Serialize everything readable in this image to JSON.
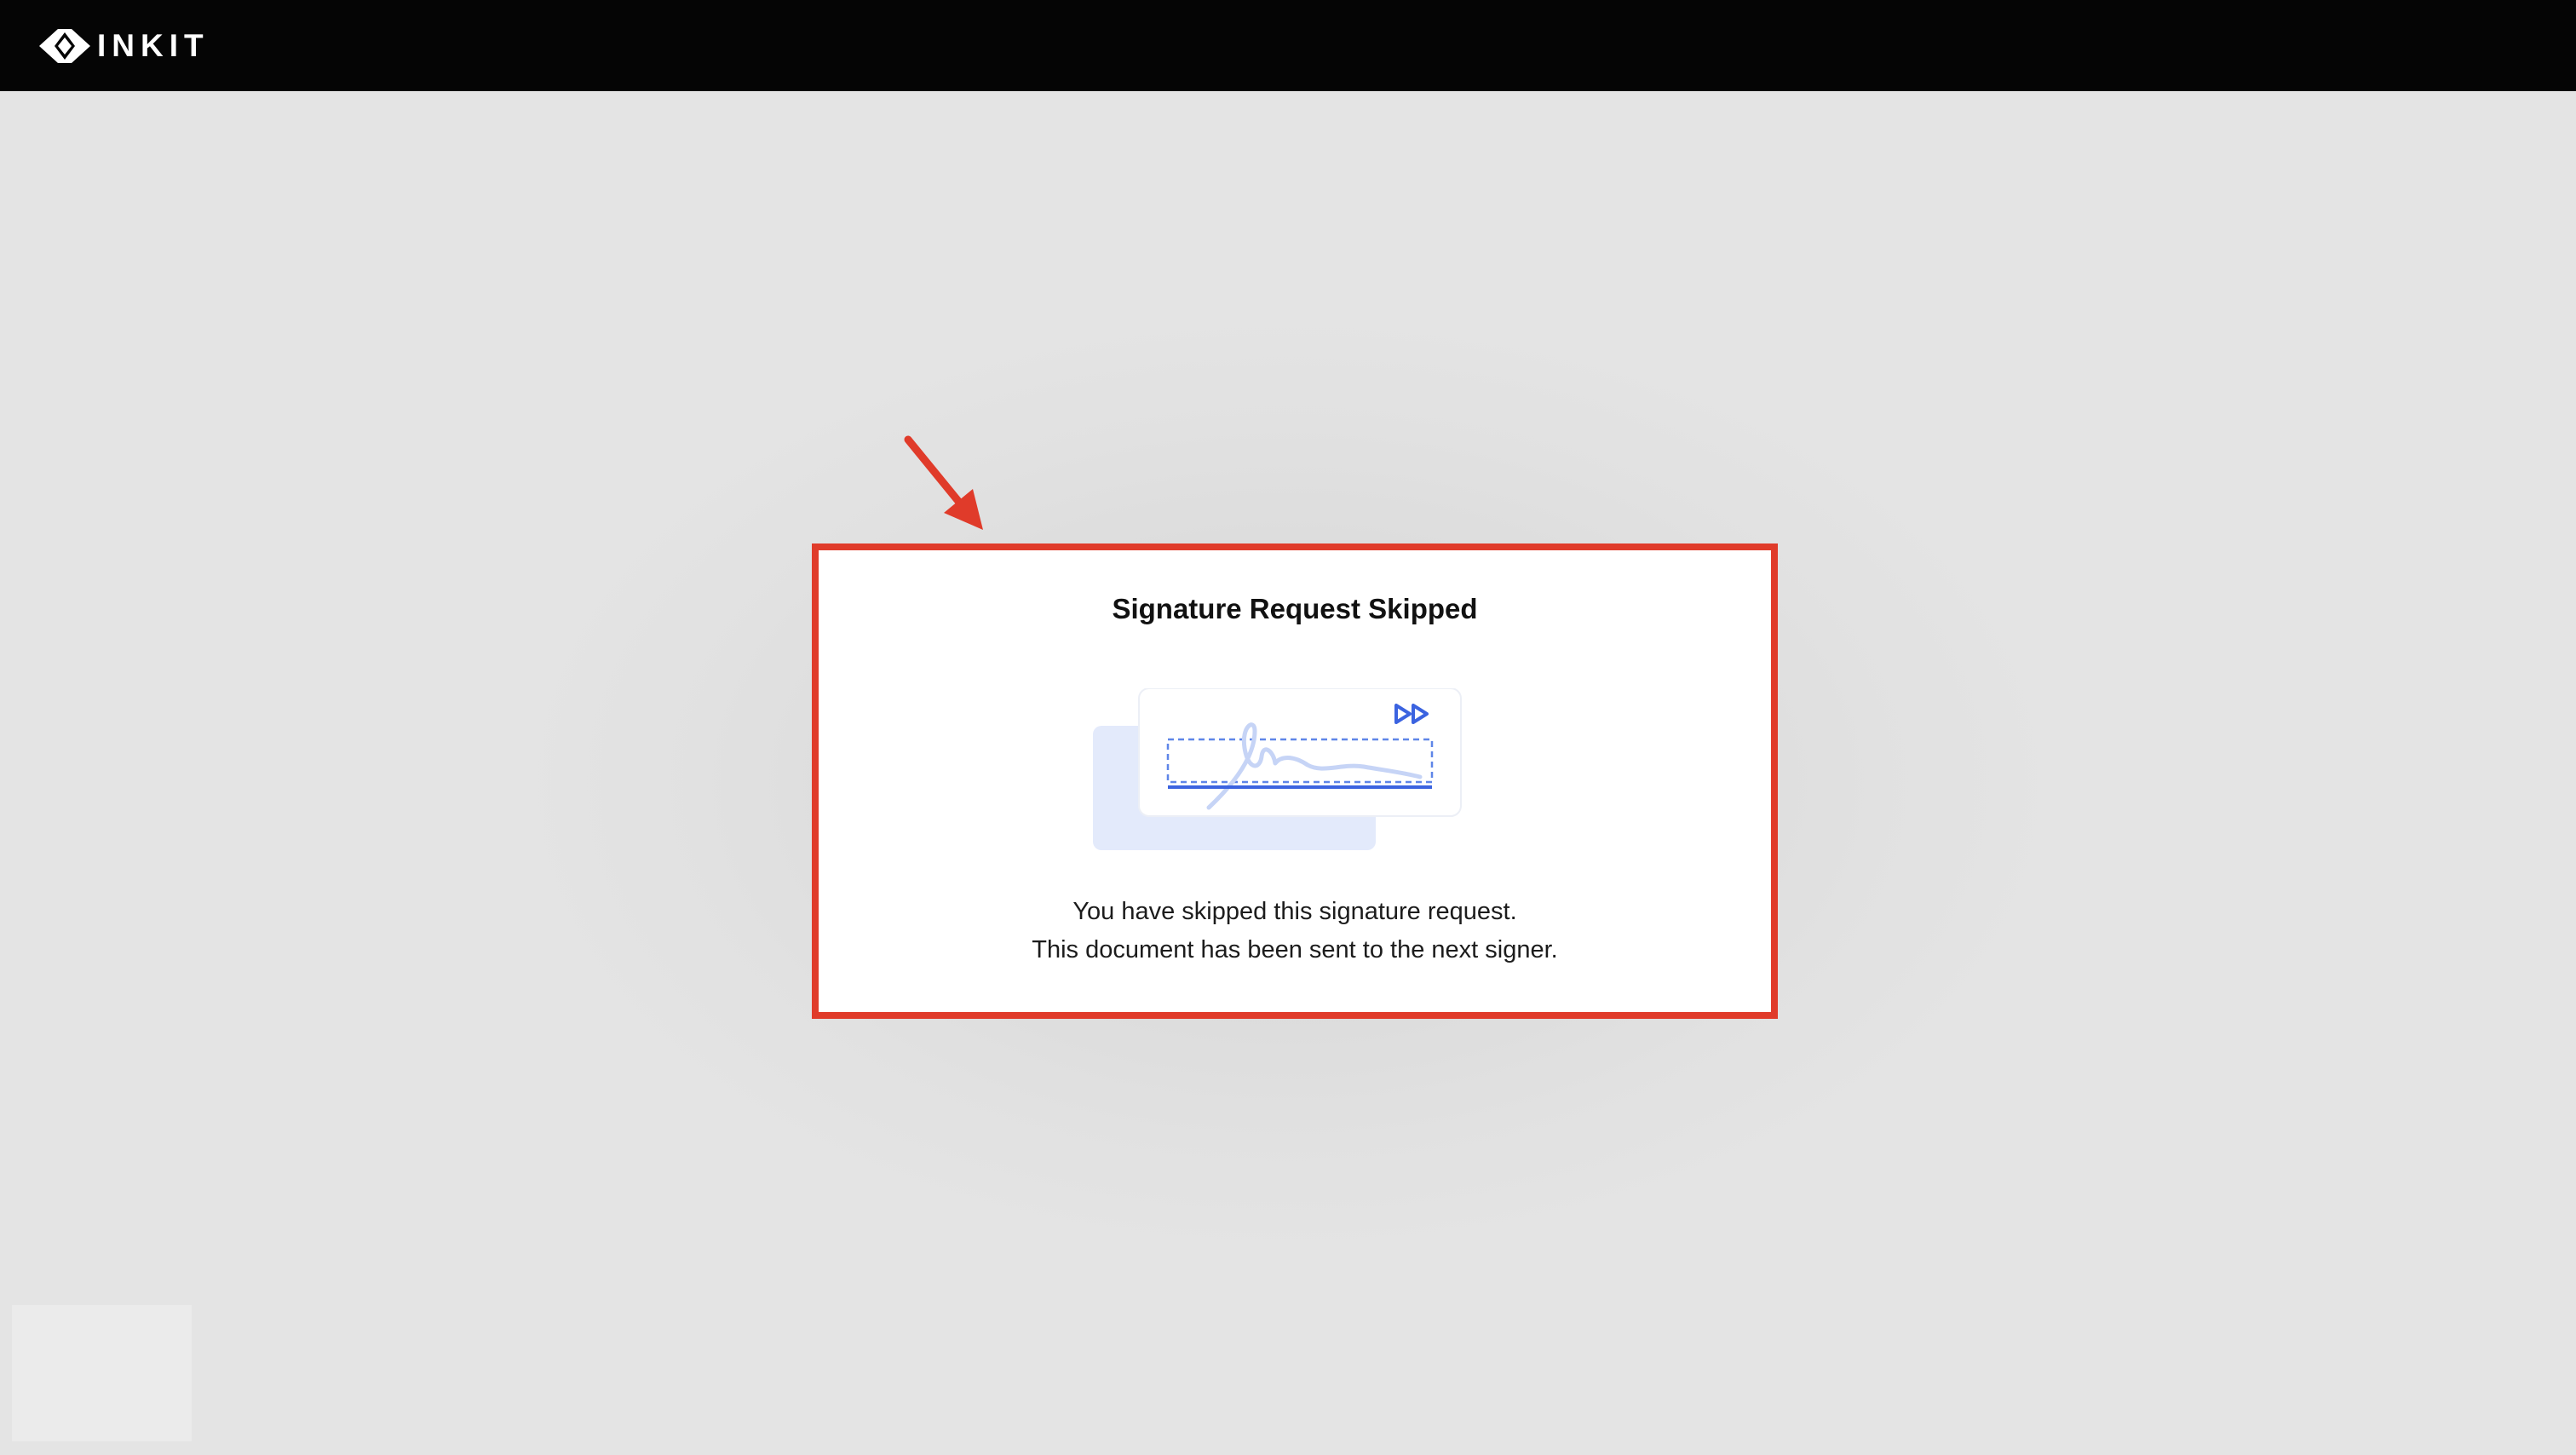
{
  "header": {
    "brand_name": "INKIT",
    "logo_icon": "inkit-logo-icon"
  },
  "dialog": {
    "title": "Signature Request Skipped",
    "illustration_icon": "skipped-signature-illustration",
    "skip_icon": "fast-forward-icon",
    "message_line1": "You have skipped this signature request.",
    "message_line2": "This document has been sent to the next signer."
  },
  "annotation": {
    "arrow_icon": "red-arrow-icon",
    "highlight_color": "#e03b2a"
  },
  "colors": {
    "header_bg": "#050505",
    "accent_blue": "#3b63e0",
    "illustration_back": "#e3eafb",
    "signature_stroke": "#c6d4f6"
  }
}
